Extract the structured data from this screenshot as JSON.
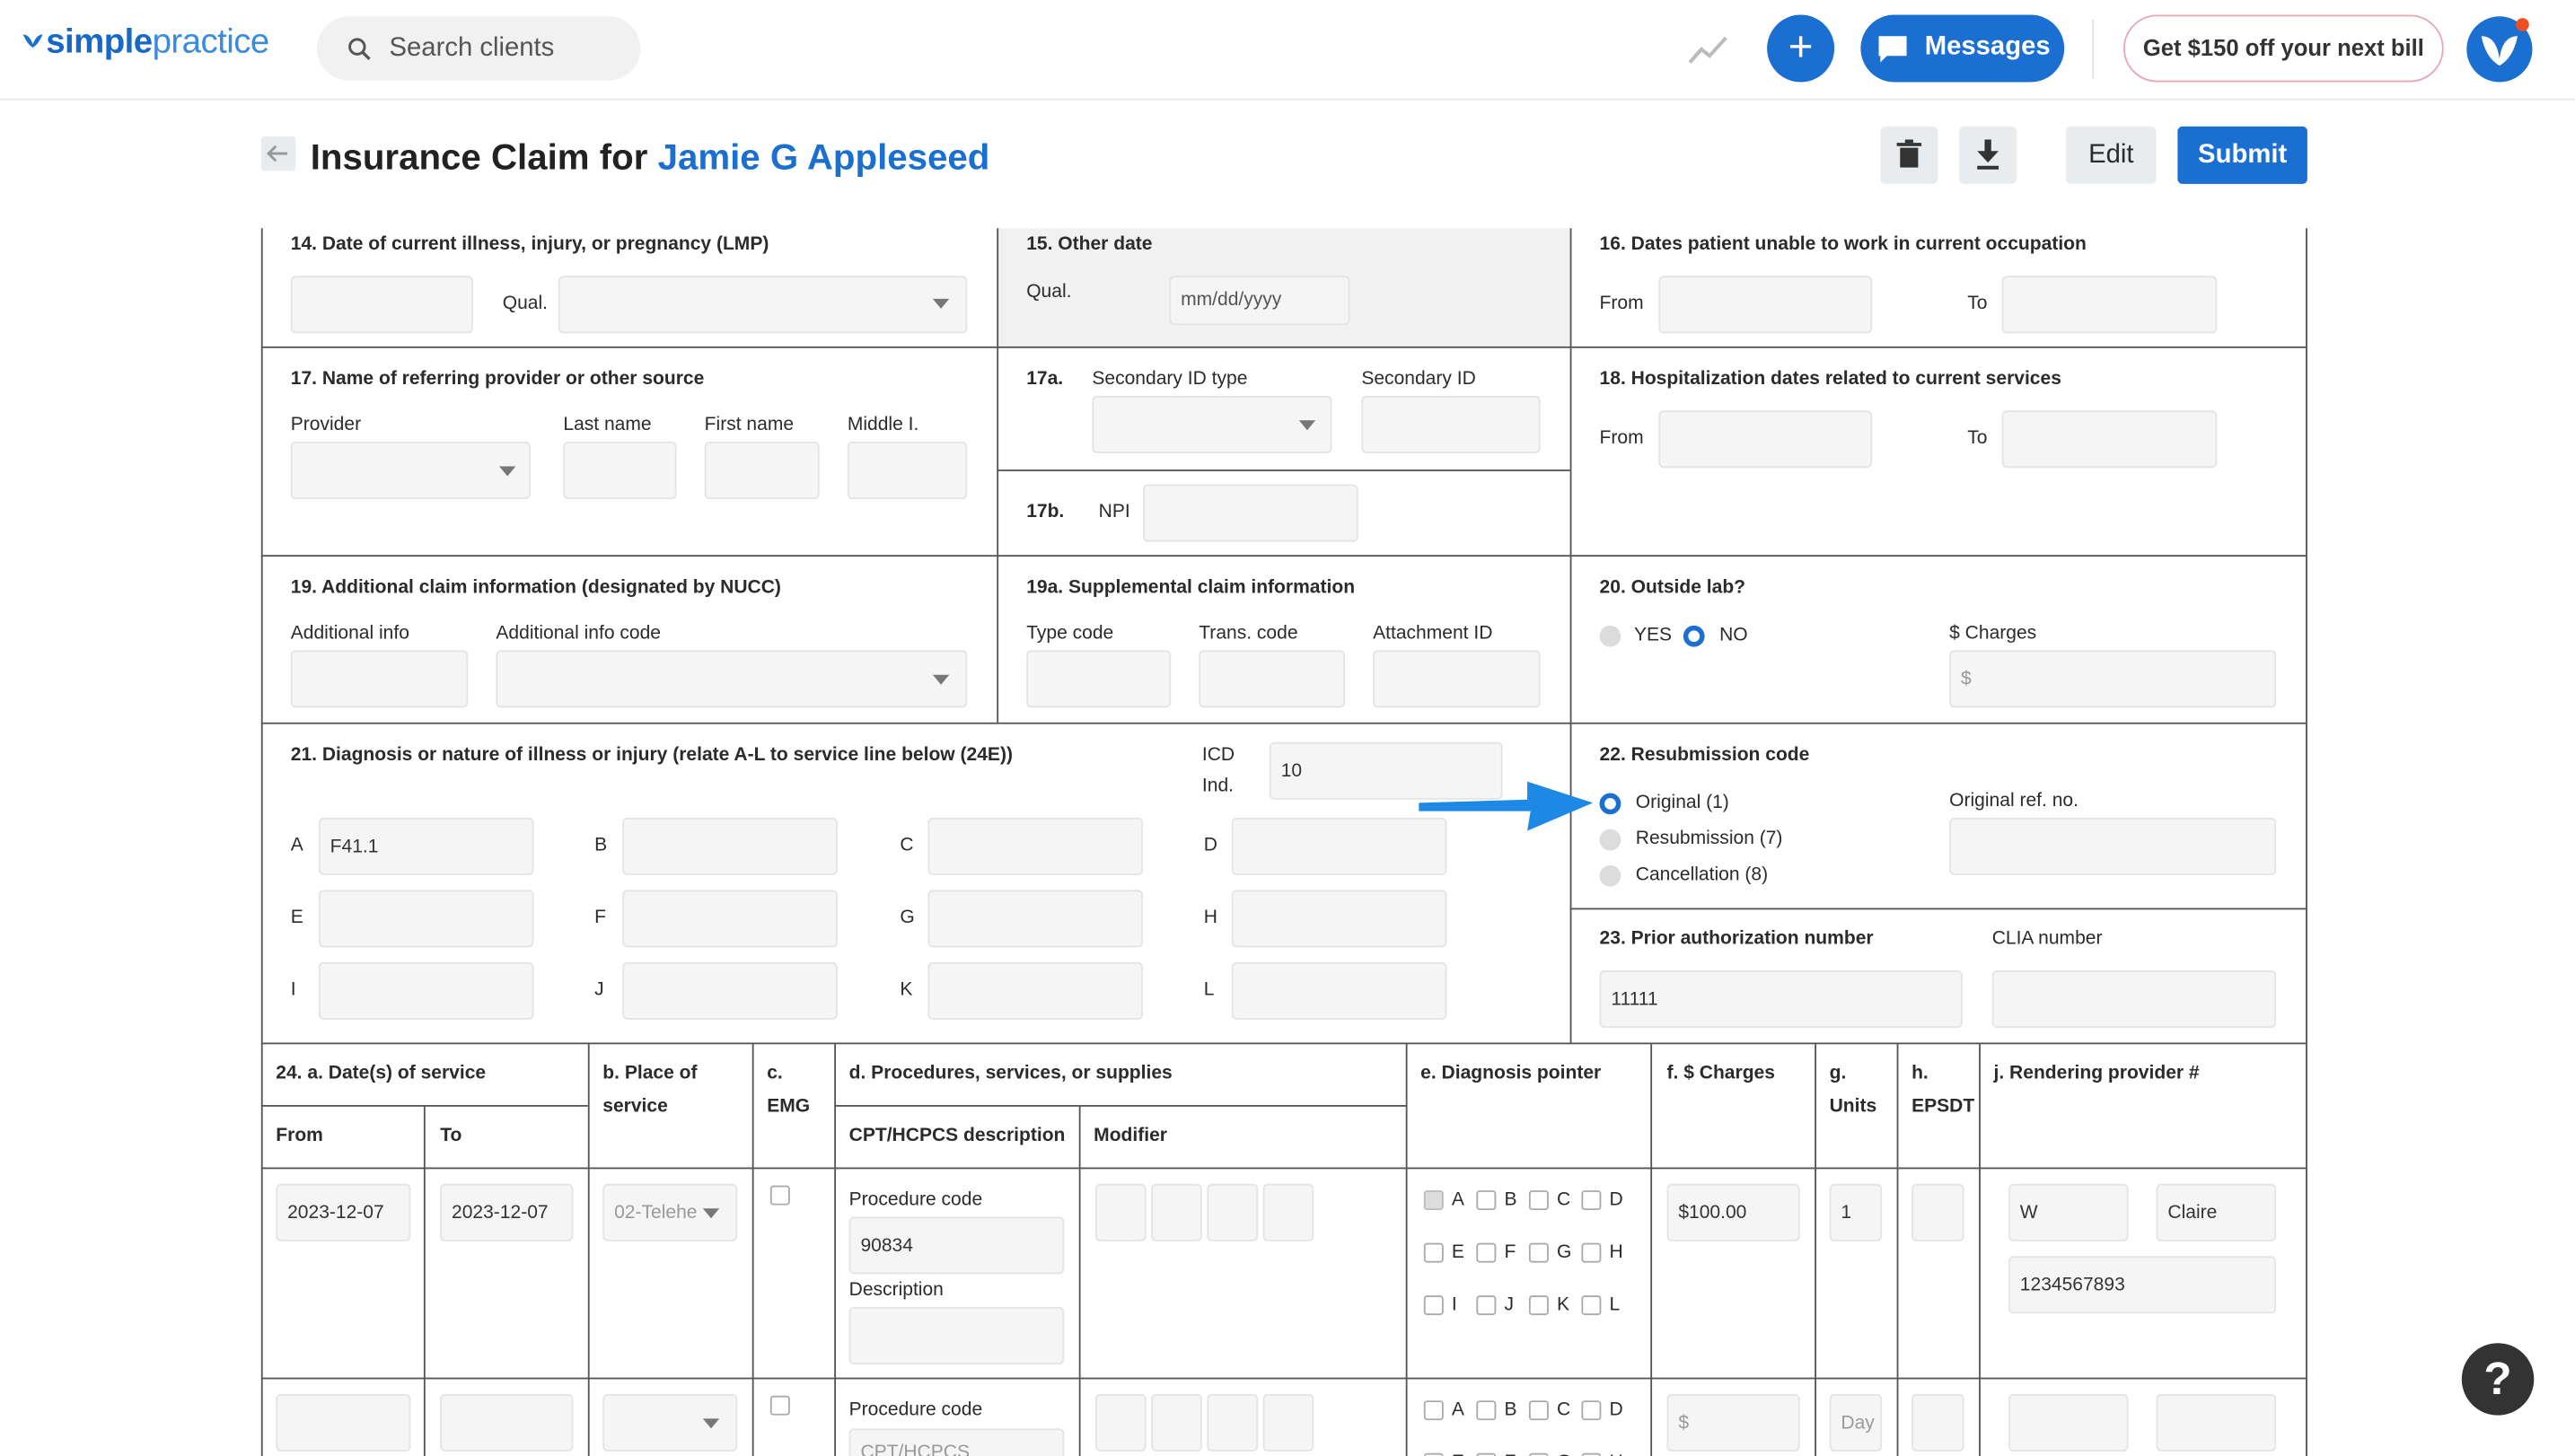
{
  "brand": {
    "logo_bold": "simple",
    "logo_light": "practice"
  },
  "header": {
    "search_placeholder": "Search clients",
    "messages_label": "Messages",
    "promo_label": "Get $150 off your next bill",
    "colors": {
      "accent": "#1a6fd1",
      "promo_border": "#e9a6b3"
    }
  },
  "page": {
    "title_prefix": "Insurance Claim for",
    "client_name": "Jamie G Appleseed",
    "edit_label": "Edit",
    "submit_label": "Submit"
  },
  "box14": {
    "title": "14. Date of current illness, injury, or pregnancy (LMP)",
    "qual_label": "Qual."
  },
  "box15": {
    "title": "15. Other date",
    "qual_label": "Qual.",
    "date_placeholder": "mm/dd/yyyy"
  },
  "box16": {
    "title": "16. Dates patient unable to work in current occupation",
    "from_label": "From",
    "to_label": "To"
  },
  "box17": {
    "title": "17. Name of referring provider or other source",
    "provider_label": "Provider",
    "last_label": "Last name",
    "first_label": "First name",
    "middle_label": "Middle I."
  },
  "box17a": {
    "num": "17a.",
    "type_label": "Secondary ID type",
    "id_label": "Secondary ID"
  },
  "box17b": {
    "num": "17b.",
    "npi_label": "NPI"
  },
  "box18": {
    "title": "18. Hospitalization dates related to current services",
    "from_label": "From",
    "to_label": "To"
  },
  "box19": {
    "title": "19. Additional claim information (designated by NUCC)",
    "info_label": "Additional info",
    "code_label": "Additional info code"
  },
  "box19a": {
    "title": "19a. Supplemental claim information",
    "type_label": "Type code",
    "trans_label": "Trans. code",
    "attach_label": "Attachment ID"
  },
  "box20": {
    "title": "20. Outside lab?",
    "yes_label": "YES",
    "no_label": "NO",
    "charges_label": "$ Charges",
    "charges_placeholder": "$"
  },
  "box21": {
    "title": "21. Diagnosis or nature of illness or injury (relate A-L to service line below (24E))",
    "icd_label_1": "ICD",
    "icd_label_2": "Ind.",
    "icd_value": "10",
    "letters": [
      "A",
      "B",
      "C",
      "D",
      "E",
      "F",
      "G",
      "H",
      "I",
      "J",
      "K",
      "L"
    ],
    "values": [
      "F41.1",
      "",
      "",
      "",
      "",
      "",
      "",
      "",
      "",
      "",
      "",
      ""
    ]
  },
  "box22": {
    "title": "22. Resubmission code",
    "options": [
      "Original (1)",
      "Resubmission (7)",
      "Cancellation (8)"
    ],
    "selected_index": 0,
    "ref_label": "Original ref. no."
  },
  "box23": {
    "title": "23. Prior authorization number",
    "value": "11111",
    "clia_label": "CLIA number"
  },
  "box24": {
    "col_a": "24. a. Date(s) of service",
    "from_label": "From",
    "to_label": "To",
    "col_b_1": "b. Place of",
    "col_b_2": "service",
    "col_c_1": "c.",
    "col_c_2": "EMG",
    "col_d": "d. Procedures, services, or supplies",
    "cpt_label": "CPT/HCPCS description",
    "modifier_label": "Modifier",
    "col_e": "e. Diagnosis pointer",
    "col_f": "f. $ Charges",
    "col_g_1": "g.",
    "col_g_2": "Units",
    "col_h_1": "h.",
    "col_h_2": "EPSDT",
    "col_j": "j. Rendering provider #",
    "pointer_letters": [
      "A",
      "B",
      "C",
      "D",
      "E",
      "F",
      "G",
      "H",
      "I",
      "J",
      "K",
      "L"
    ],
    "rows": [
      {
        "from": "2023-12-07",
        "to": "2023-12-07",
        "place": "02-Telehe",
        "proc_code_label": "Procedure code",
        "proc_code": "90834",
        "desc_label": "Description",
        "charges": "$100.00",
        "units": "1",
        "prov_first": "W",
        "prov_last": "Claire",
        "prov_npi": "1234567893",
        "checked_pointer": "A"
      },
      {
        "proc_code_label": "Procedure code",
        "proc_code_placeholder": "CPT/HCPCS",
        "charges_placeholder": "$",
        "units_placeholder": "Day"
      }
    ]
  },
  "help_label": "?"
}
